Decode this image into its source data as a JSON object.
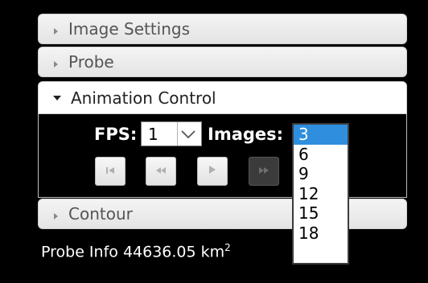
{
  "panels": {
    "image_settings": "Image Settings",
    "probe": "Probe",
    "animation_control": "Animation Control",
    "contour": "Contour"
  },
  "fps": {
    "label": "FPS:",
    "value": "1"
  },
  "images": {
    "label": "Images:",
    "options": [
      "3",
      "6",
      "9",
      "12",
      "15",
      "18"
    ],
    "selected": "3"
  },
  "playback_icons": [
    "skip-to-start-icon",
    "rewind-icon",
    "play-icon",
    "fast-forward-icon"
  ],
  "probe_info": {
    "label": "Probe Info",
    "value": "44636.05",
    "unit": "km",
    "unit_power": "2"
  },
  "colors": {
    "selected_option": "#2f8fde",
    "page_background": "#000000"
  }
}
